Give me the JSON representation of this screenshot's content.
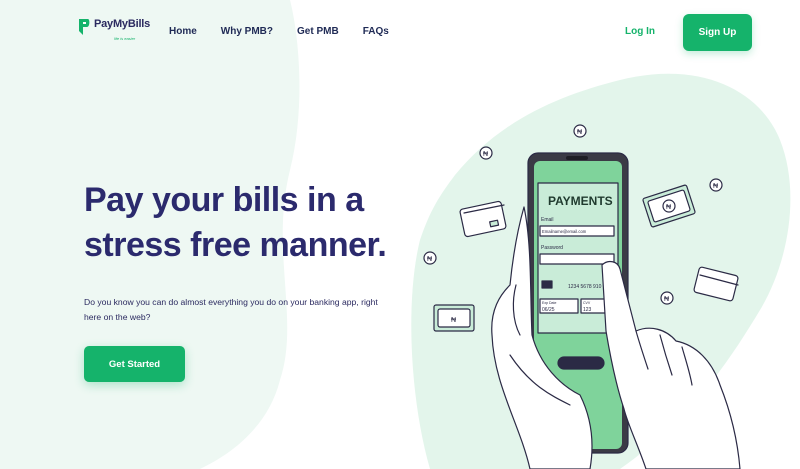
{
  "brand": {
    "name": "PayMyBills",
    "tagline": "life is easier",
    "accent_color": "#15b36b",
    "heading_color": "#2b2a6d"
  },
  "nav": {
    "items": [
      {
        "label": "Home"
      },
      {
        "label": "Why PMB?"
      },
      {
        "label": "Get PMB"
      },
      {
        "label": "FAQs"
      }
    ],
    "login_label": "Log In",
    "signup_label": "Sign Up"
  },
  "hero": {
    "title": "Pay your bills in a stress free manner.",
    "subtitle": "Do you know you can do almost everything you do on your banking app, right here on the web?",
    "cta_label": "Get Started"
  },
  "illustration": {
    "screen_title": "PAYMENTS",
    "email_label": "Email",
    "email_placeholder": "Emailname@email.com",
    "password_label": "Password",
    "card_number": "1234 5678 910",
    "expiry_label": "Exp Date",
    "expiry_value": "06/25",
    "cvv_label": "CVV",
    "cvv_value": "123",
    "currency_symbol": "₦",
    "icons": [
      "phone-icon",
      "hand-icon",
      "credit-card-icon",
      "banknote-icon",
      "naira-coin-icon"
    ]
  }
}
